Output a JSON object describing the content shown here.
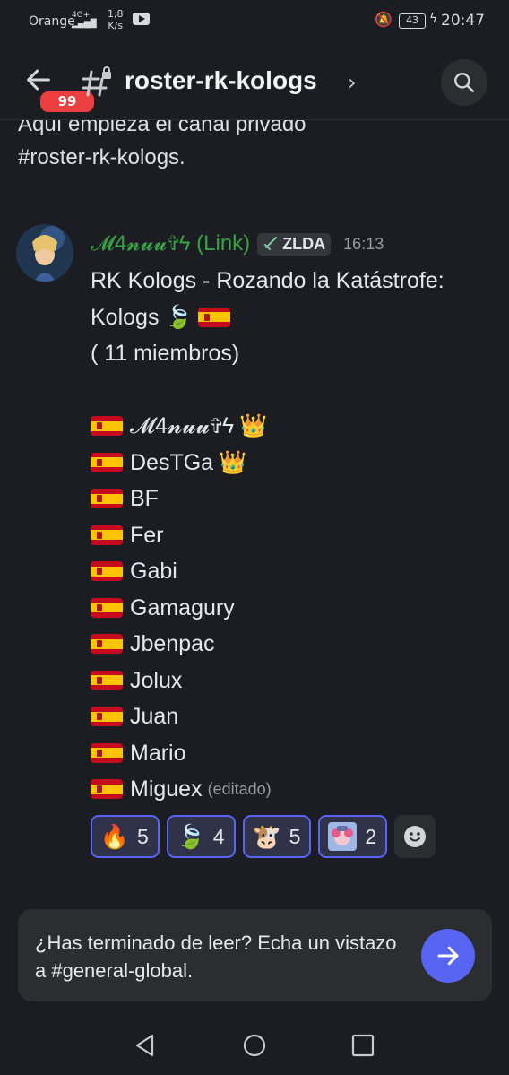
{
  "status_bar": {
    "carrier": "Orange",
    "network": "4G+",
    "speed_value": "1,8",
    "speed_unit": "K/s",
    "battery": "43",
    "time": "20:47"
  },
  "header": {
    "unread_badge": "99",
    "channel_name": "roster-rk-kologs"
  },
  "intro": {
    "line1": "Aquí empieza el canal privado",
    "line2": "#roster-rk-kologs."
  },
  "message": {
    "author": "𝓜4𝓷𝓾𝓾✞ϟ (Link)",
    "tag": "ZLDA",
    "time": "16:13",
    "lines": [
      "RK Kologs - Rozando la Katástrofe:",
      "Kologs",
      "( 11 miembros)"
    ],
    "members": [
      "𝓜4𝓷𝓾𝓾✞ϟ",
      "DesTGa",
      "BF",
      "Fer",
      "Gabi",
      "Gamagury",
      "Jbenpac",
      "Jolux",
      "Juan",
      "Mario",
      "Miguex"
    ],
    "edited": "(editado)"
  },
  "reactions": [
    {
      "icon": "fire-emoji-icon",
      "count": "5"
    },
    {
      "icon": "leaf-emoji-icon",
      "count": "4"
    },
    {
      "icon": "bull-emoji-icon",
      "count": "5"
    },
    {
      "icon": "character-emoji-icon",
      "count": "2"
    }
  ],
  "prompt_card": {
    "text": "¿Has terminado de leer? Echa un vistazo a #general-global."
  },
  "colors": {
    "background": "#1c1d22",
    "accent": "#5865f2",
    "author": "#3aa144",
    "badge": "#ec3e3f"
  }
}
